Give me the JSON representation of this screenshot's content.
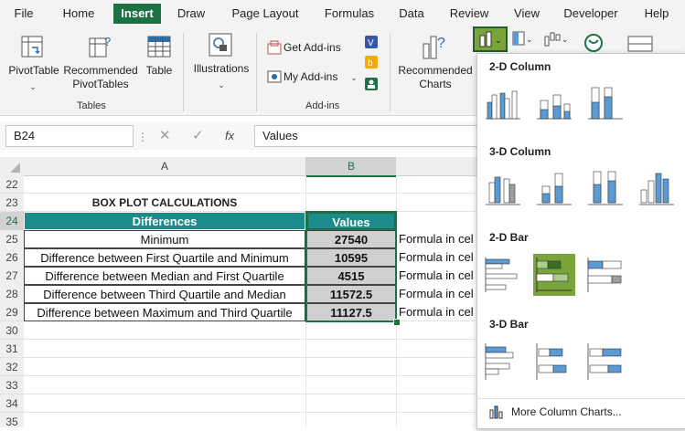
{
  "menu": [
    "File",
    "Home",
    "Insert",
    "Draw",
    "Page Layout",
    "Formulas",
    "Data",
    "Review",
    "View",
    "Developer",
    "Help"
  ],
  "active_menu": "Insert",
  "ribbon": {
    "pivottable": "PivotTable",
    "recommended_pivot_1": "Recommended",
    "recommended_pivot_2": "PivotTables",
    "table": "Table",
    "tables_group": "Tables",
    "illustrations": "Illustrations",
    "get_addins": "Get Add-ins",
    "my_addins": "My Add-ins",
    "addins_group": "Add-ins",
    "recommended_charts_1": "Recommended",
    "recommended_charts_2": "Charts"
  },
  "formula_bar": {
    "name_box": "B24",
    "fx": "fx",
    "content": "Values"
  },
  "columns": [
    "A",
    "B"
  ],
  "rows": [
    "22",
    "23",
    "24",
    "25",
    "26",
    "27",
    "28",
    "29",
    "30",
    "31",
    "32",
    "33",
    "34",
    "35"
  ],
  "sheet": {
    "title": "BOX PLOT CALCULATIONS",
    "header_a": "Differences",
    "header_b": "Values",
    "data": [
      {
        "label": "Minimum",
        "value": "27540",
        "note": "Formula in cel"
      },
      {
        "label": "Difference between First Quartile and Minimum",
        "value": "10595",
        "note": "Formula in cel"
      },
      {
        "label": "Difference between Median and First Quartile",
        "value": "4515",
        "note": "Formula in cel"
      },
      {
        "label": "Difference between Third Quartile and Median",
        "value": "11572.5",
        "note": "Formula in cel"
      },
      {
        "label": "Difference between Maximum and Third Quartile",
        "value": "11127.5",
        "note": "Formula in cel"
      }
    ]
  },
  "dropdown": {
    "sections": [
      "2-D Column",
      "3-D Column",
      "2-D Bar",
      "3-D Bar"
    ],
    "more": "More Column Charts..."
  },
  "colors": {
    "excel_green": "#1e7145",
    "header_teal": "#1c8b8b",
    "value_gray": "#d0d0d0",
    "selected": "#7aa33a",
    "chart_blue": "#5b9bd5"
  }
}
